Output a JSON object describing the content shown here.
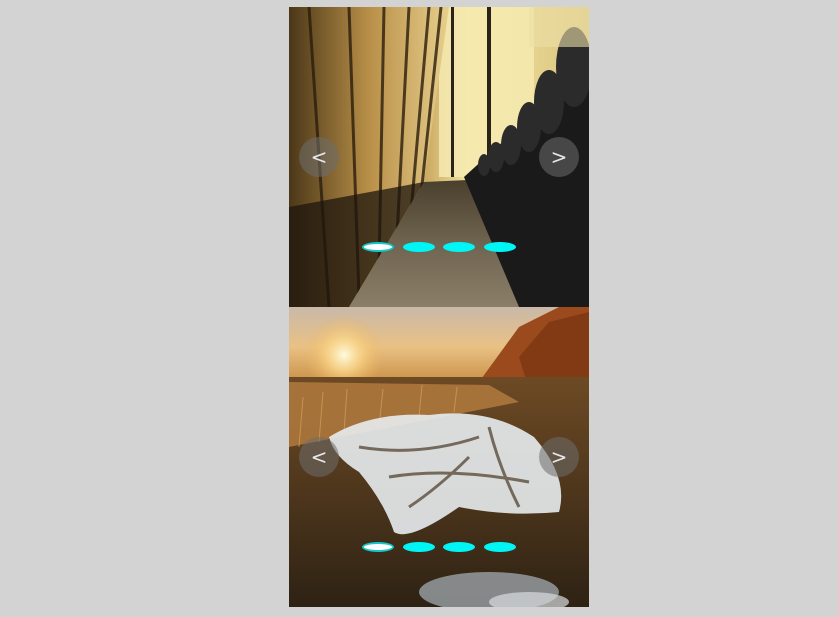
{
  "sliders": [
    {
      "image": "interior-wooden-corridor-photo",
      "prev_label": "<",
      "next_label": ">",
      "active_index": 0,
      "dot_count": 4
    },
    {
      "image": "sunset-landscape-with-ice-patch-photo",
      "prev_label": "<",
      "next_label": ">",
      "active_index": 0,
      "dot_count": 4
    }
  ],
  "colors": {
    "page_background": "#d3d3d3",
    "dot_inactive": "#00f5f5",
    "dot_active": "#ffffff",
    "dot_active_border": "#12c8c8",
    "nav_button_background": "rgba(110,110,110,0.55)"
  }
}
